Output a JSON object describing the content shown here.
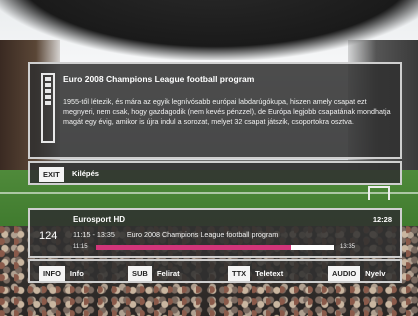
{
  "info": {
    "title": "Euro 2008 Champions League football program",
    "description": "1955-től létezik, és mára az egyik legnívósabb európai labdarúgókupa, hiszen amely csapat ezt megnyeri, nem csak, hogy gazdagodik (nem kevés pénzzel), de Európa legjobb csapatának mondhatja magát egy évig, amikor is újra indul a sorozat, melyet 32 csapat játszik, csoportokra osztva."
  },
  "exit": {
    "key": "EXIT",
    "label": "Kilépés"
  },
  "epg": {
    "channel_number": "124",
    "channel_name": "Eurosport HD",
    "clock": "12:28",
    "time_range": "11:15 - 13:35",
    "program_title": "Euro 2008 Champions League football program",
    "start": "11:15",
    "end": "13:35",
    "progress": 0.82
  },
  "keys": [
    {
      "key": "INFO",
      "label": "Info"
    },
    {
      "key": "SUB",
      "label": "Felirat"
    },
    {
      "key": "TTX",
      "label": "Teletext"
    },
    {
      "key": "AUDIO",
      "label": "Nyelv"
    }
  ],
  "colors": {
    "progress_fill": "#d2357a",
    "progress_track": "#ffffff",
    "panel_border": "#cfcfcf"
  }
}
